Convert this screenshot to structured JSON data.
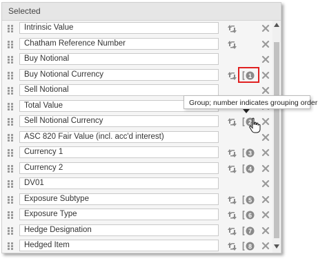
{
  "panel": {
    "title": "Selected"
  },
  "rows": [
    {
      "label": "Intrinsic Value",
      "sortable": true,
      "group_order": null
    },
    {
      "label": "Chatham Reference Number",
      "sortable": true,
      "group_order": null
    },
    {
      "label": "Buy Notional",
      "sortable": false,
      "group_order": null
    },
    {
      "label": "Buy Notional Currency",
      "sortable": true,
      "group_order": "1"
    },
    {
      "label": "Sell Notional",
      "sortable": false,
      "group_order": null
    },
    {
      "label": "Total Value",
      "sortable": false,
      "group_order": null
    },
    {
      "label": "Sell Notional Currency",
      "sortable": true,
      "group_order": "2"
    },
    {
      "label": "ASC 820 Fair Value (incl. acc'd interest)",
      "sortable": false,
      "group_order": null
    },
    {
      "label": "Currency 1",
      "sortable": true,
      "group_order": "3"
    },
    {
      "label": "Currency 2",
      "sortable": true,
      "group_order": "4"
    },
    {
      "label": "DV01",
      "sortable": false,
      "group_order": null
    },
    {
      "label": "Exposure Subtype",
      "sortable": true,
      "group_order": "5"
    },
    {
      "label": "Exposure Type",
      "sortable": true,
      "group_order": "6"
    },
    {
      "label": "Hedge Designation",
      "sortable": true,
      "group_order": "7"
    },
    {
      "label": "Hedged Item",
      "sortable": true,
      "group_order": "8"
    }
  ],
  "tooltip": {
    "text": "Group; number indicates grouping order"
  },
  "colors": {
    "icon": "#8a8a8a",
    "highlight": "#e02020"
  },
  "icons": {
    "sort": "sort-icon",
    "group": "group-icon",
    "remove": "remove-icon",
    "grip": "drag-handle-icon"
  }
}
